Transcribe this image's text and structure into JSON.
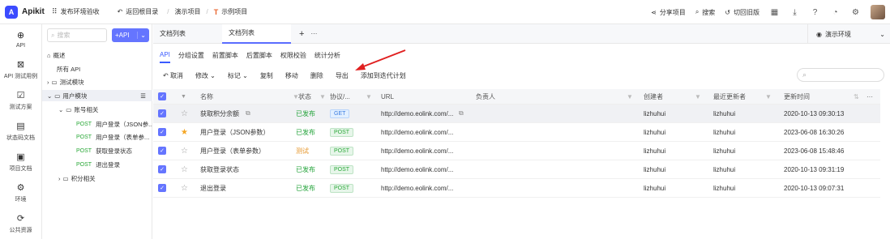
{
  "topbar": {
    "logo_text": "Apikit",
    "project_space": "发布环境验收",
    "back_label": "返回根目录",
    "breadcrumb_1": "演示项目",
    "breadcrumb_sep": "/",
    "breadcrumb_2": "示例项目",
    "share": "分享项目",
    "search": "搜索",
    "old_version": "切回旧版"
  },
  "leftnav": [
    {
      "label": "API",
      "icon": "crosshair-icon"
    },
    {
      "label": "API 测试用例",
      "icon": "test-case-icon"
    },
    {
      "label": "测试方案",
      "icon": "checklist-icon"
    },
    {
      "label": "状态码文档",
      "icon": "document-icon"
    },
    {
      "label": "项目文档",
      "icon": "project-doc-icon"
    },
    {
      "label": "环境",
      "icon": "environment-icon"
    },
    {
      "label": "公共资源",
      "icon": "resource-icon"
    }
  ],
  "tree": {
    "search_placeholder": "搜索",
    "add_label": "+API",
    "overview": "概述",
    "all_api": "所有 API",
    "group_test": "测试模块",
    "group_user": "用户模块",
    "group_account": "账号相关",
    "items": [
      {
        "method": "POST",
        "name": "用户登录（JSON参..."
      },
      {
        "method": "POST",
        "name": "用户登录（表单参..."
      },
      {
        "method": "POST",
        "name": "获取登录状态"
      },
      {
        "method": "POST",
        "name": "退出登录"
      }
    ],
    "group_points": "积分相关"
  },
  "tabs": [
    {
      "label": "文档列表",
      "active": false
    },
    {
      "label": "文档列表",
      "active": true
    }
  ],
  "tabs_extra": {
    "plus": "+",
    "more": "···"
  },
  "env_label": "演示环境",
  "subtabs": [
    "API",
    "分组设置",
    "前置脚本",
    "后置脚本",
    "权限校验",
    "统计分析"
  ],
  "actions": [
    "取消",
    "修改",
    "标记",
    "复制",
    "移动",
    "删除",
    "导出",
    "添加到迭代计划"
  ],
  "actions_search_icon": "search-icon",
  "table": {
    "headers": {
      "name": "名称",
      "status": "状态",
      "protocol": "协议/...",
      "url": "URL",
      "owner": "负责人",
      "creator": "创建者",
      "updater": "最近更新者",
      "updated": "更新时间"
    },
    "rows": [
      {
        "starred": false,
        "name": "获取积分余额",
        "status": "已发布",
        "status_type": "ok",
        "method": "GET",
        "url": "http://demo.eolink.com/...",
        "owner": "",
        "creator": "lizhuhui",
        "updater": "lizhuhui",
        "updated": "2020-10-13 09:30:13"
      },
      {
        "starred": true,
        "name": "用户登录（JSON参数）",
        "status": "已发布",
        "status_type": "ok",
        "method": "POST",
        "url": "http://demo.eolink.com/...",
        "owner": "",
        "creator": "lizhuhui",
        "updater": "lizhuhui",
        "updated": "2023-06-08 16:30:26"
      },
      {
        "starred": false,
        "name": "用户登录（表单参数）",
        "status": "测试",
        "status_type": "test",
        "method": "POST",
        "url": "http://demo.eolink.com/...",
        "owner": "",
        "creator": "lizhuhui",
        "updater": "lizhuhui",
        "updated": "2023-06-08 15:48:46"
      },
      {
        "starred": false,
        "name": "获取登录状态",
        "status": "已发布",
        "status_type": "ok",
        "method": "POST",
        "url": "http://demo.eolink.com/...",
        "owner": "",
        "creator": "lizhuhui",
        "updater": "lizhuhui",
        "updated": "2020-10-13 09:31:19"
      },
      {
        "starred": false,
        "name": "退出登录",
        "status": "已发布",
        "status_type": "ok",
        "method": "POST",
        "url": "http://demo.eolink.com/...",
        "owner": "",
        "creator": "lizhuhui",
        "updater": "lizhuhui",
        "updated": "2020-10-13 09:07:31"
      }
    ]
  },
  "colors": {
    "accent": "#5b6cff",
    "annotation_arrow": "#e02020",
    "published": "#23a33a",
    "testing": "#e6962a"
  }
}
